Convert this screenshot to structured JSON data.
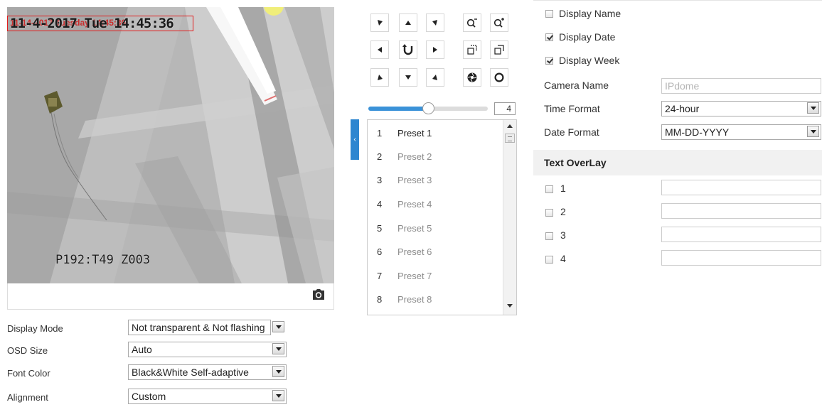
{
  "video": {
    "osd_date_text": "11-4-2017 Tue 14:45:36",
    "osd_overlay_text": "11-14-2017 Tuesday 14:45:36",
    "osd_camera_text": "P192:T49   Z003",
    "snapshot_icon": "camera-icon"
  },
  "left_form": {
    "display_mode": {
      "label": "Display Mode",
      "value": "Not transparent & Not flashing"
    },
    "osd_size": {
      "label": "OSD Size",
      "value": "Auto"
    },
    "font_color": {
      "label": "Font Color",
      "value": "Black&White Self-adaptive"
    },
    "alignment": {
      "label": "Alignment",
      "value": "Custom"
    }
  },
  "ptz": {
    "buttons": [
      "arrow-up-left-icon",
      "arrow-up-icon",
      "arrow-up-right-icon",
      "zoom-out-icon",
      "zoom-in-icon",
      "arrow-left-icon",
      "auto-pan-icon",
      "arrow-right-icon",
      "focus-near-icon",
      "focus-far-icon",
      "arrow-down-left-icon",
      "arrow-down-icon",
      "arrow-down-right-icon",
      "iris-close-icon",
      "iris-open-icon"
    ],
    "speed": {
      "value": "4",
      "level_fraction": 0.5
    },
    "presets": [
      {
        "num": "1",
        "name": "Preset 1"
      },
      {
        "num": "2",
        "name": "Preset 2"
      },
      {
        "num": "3",
        "name": "Preset 3"
      },
      {
        "num": "4",
        "name": "Preset 4"
      },
      {
        "num": "5",
        "name": "Preset 5"
      },
      {
        "num": "6",
        "name": "Preset 6"
      },
      {
        "num": "7",
        "name": "Preset 7"
      },
      {
        "num": "8",
        "name": "Preset 8"
      }
    ]
  },
  "right_panel": {
    "display_name": {
      "label": "Display Name",
      "checked": false
    },
    "display_date": {
      "label": "Display Date",
      "checked": true
    },
    "display_week": {
      "label": "Display Week",
      "checked": true
    },
    "camera_name": {
      "label": "Camera Name",
      "placeholder": "IPdome"
    },
    "time_format": {
      "label": "Time Format",
      "value": "24-hour"
    },
    "date_format": {
      "label": "Date Format",
      "value": "MM-DD-YYYY"
    },
    "text_overlay": {
      "title": "Text OverLay",
      "items": [
        {
          "label": "1",
          "checked": false,
          "value": ""
        },
        {
          "label": "2",
          "checked": false,
          "value": ""
        },
        {
          "label": "3",
          "checked": false,
          "value": ""
        },
        {
          "label": "4",
          "checked": false,
          "value": ""
        }
      ]
    }
  },
  "colors": {
    "accent": "#2e86d0",
    "osd_border": "#e21d1d",
    "slider_fill": "#3a92d8"
  }
}
